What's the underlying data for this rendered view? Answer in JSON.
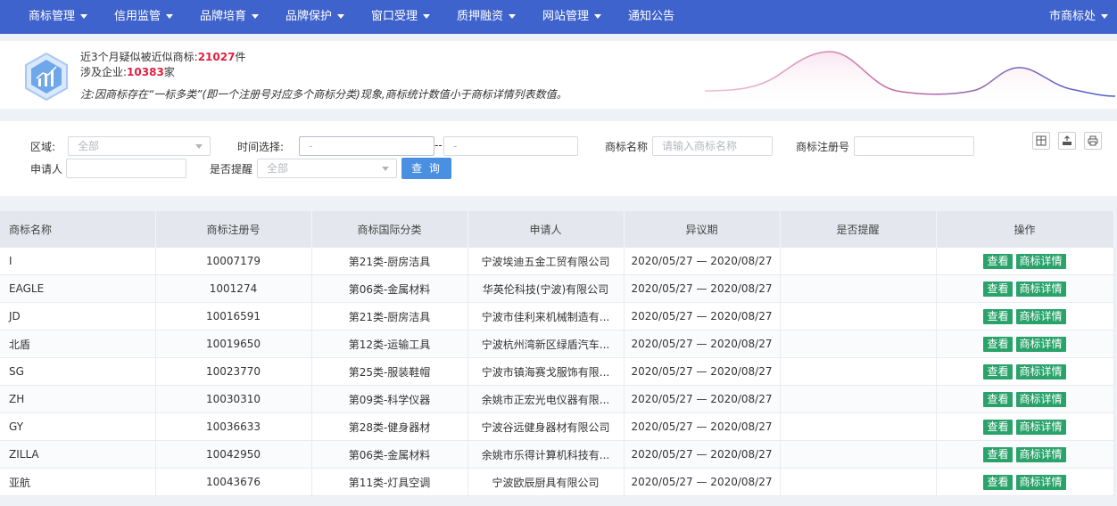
{
  "nav": {
    "items": [
      {
        "label": "商标管理",
        "dropdown": true
      },
      {
        "label": "信用监管",
        "dropdown": true
      },
      {
        "label": "品牌培育",
        "dropdown": true
      },
      {
        "label": "品牌保护",
        "dropdown": true
      },
      {
        "label": "窗口受理",
        "dropdown": true
      },
      {
        "label": "质押融资",
        "dropdown": true
      },
      {
        "label": "网站管理",
        "dropdown": true
      },
      {
        "label": "通知公告",
        "dropdown": false
      }
    ],
    "user": {
      "label": "市商标处",
      "dropdown": true
    },
    "color": "#3f63cc"
  },
  "stats": {
    "line1_prefix": "近3个月疑似被近似商标:",
    "line1_value": "21027",
    "line1_suffix": "件",
    "line2_prefix": "涉及企业:",
    "line2_value": "10383",
    "line2_suffix": "家",
    "note": "注:因商标存在“一标多类”(即一个注册号对应多个商标分类)现象,商标统计数值小于商标详情列表数值。",
    "highlight_color": "#e0213f"
  },
  "filters": {
    "region_label": "区域:",
    "region_value": "全部",
    "time_label": "时间选择:",
    "time_start": "-",
    "time_separator": "--",
    "time_end": "-",
    "tm_name_label": "商标名称",
    "tm_name_placeholder": "请输入商标名称",
    "tm_reg_label": "商标注册号",
    "applicant_label": "申请人",
    "remind_label": "是否提醒",
    "remind_value": "全部",
    "query_label": "查 询",
    "icons": [
      "columns-icon",
      "export-icon",
      "print-icon"
    ]
  },
  "table": {
    "headers": [
      "商标名称",
      "商标注册号",
      "商标国际分类",
      "申请人",
      "异议期",
      "是否提醒",
      "操作"
    ],
    "view_label": "查看",
    "detail_label": "商标详情",
    "rows": [
      {
        "name": "I",
        "reg": "10007179",
        "cls": "第21类-厨房洁具",
        "applicant": "宁波埃迪五金工贸有限公司",
        "period": "2020/05/27 — 2020/08/27",
        "remind": ""
      },
      {
        "name": "EAGLE",
        "reg": "1001274",
        "cls": "第06类-金属材料",
        "applicant": "华英伦科技(宁波)有限公司",
        "period": "2020/05/27 — 2020/08/27",
        "remind": ""
      },
      {
        "name": "JD",
        "reg": "10016591",
        "cls": "第21类-厨房洁具",
        "applicant": "宁波市佳利来机械制造有...",
        "period": "2020/05/27 — 2020/08/27",
        "remind": ""
      },
      {
        "name": "北盾",
        "reg": "10019650",
        "cls": "第12类-运输工具",
        "applicant": "宁波杭州湾新区绿盾汽车...",
        "period": "2020/05/27 — 2020/08/27",
        "remind": ""
      },
      {
        "name": "SG",
        "reg": "10023770",
        "cls": "第25类-服装鞋帽",
        "applicant": "宁波市镇海赛戈服饰有限...",
        "period": "2020/05/27 — 2020/08/27",
        "remind": ""
      },
      {
        "name": "ZH",
        "reg": "10030310",
        "cls": "第09类-科学仪器",
        "applicant": "余姚市正宏光电仪器有限...",
        "period": "2020/05/27 — 2020/08/27",
        "remind": ""
      },
      {
        "name": "GY",
        "reg": "10036633",
        "cls": "第28类-健身器材",
        "applicant": "宁波谷远健身器材有限公司",
        "period": "2020/05/27 — 2020/08/27",
        "remind": ""
      },
      {
        "name": "ZILLA",
        "reg": "10042950",
        "cls": "第06类-金属材料",
        "applicant": "余姚市乐得计算机科技有...",
        "period": "2020/05/27 — 2020/08/27",
        "remind": ""
      },
      {
        "name": "亚航",
        "reg": "10043676",
        "cls": "第11类-灯具空调",
        "applicant": "宁波欧辰厨具有限公司",
        "period": "2020/05/27 — 2020/08/27",
        "remind": ""
      }
    ],
    "button_color": "#2aa36b"
  }
}
